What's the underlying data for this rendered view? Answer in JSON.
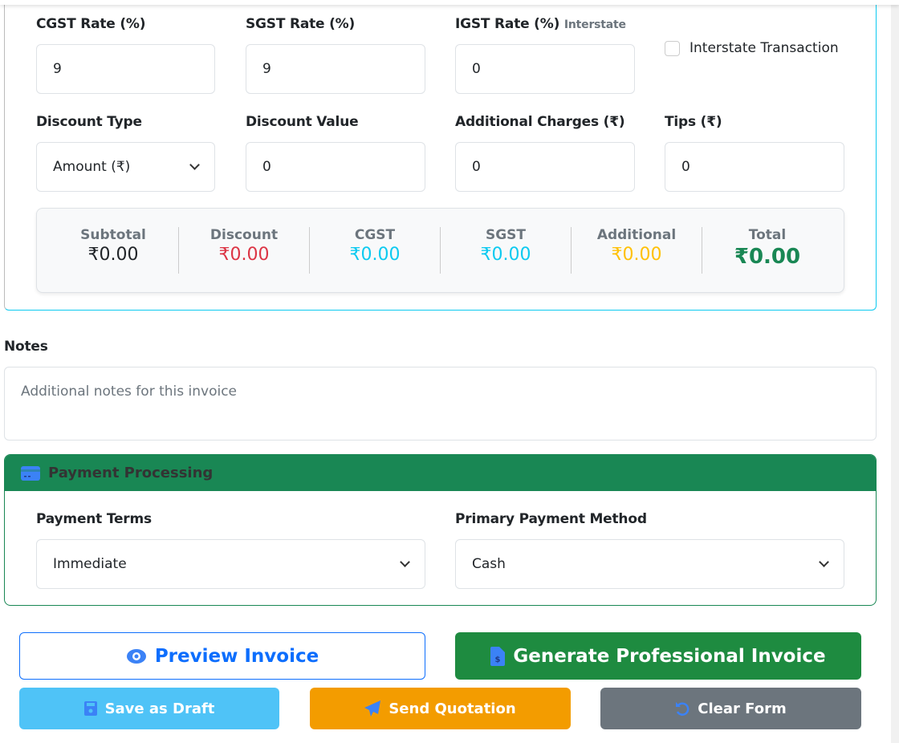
{
  "tax": {
    "cgst": {
      "label": "CGST Rate (%)",
      "value": "9"
    },
    "sgst": {
      "label": "SGST Rate (%)",
      "value": "9"
    },
    "igst": {
      "label": "IGST Rate (%)",
      "hint": "Interstate",
      "value": "0"
    },
    "interstate_label": "Interstate Transaction",
    "discount_type": {
      "label": "Discount Type",
      "value": "Amount (₹)"
    },
    "discount_value": {
      "label": "Discount Value",
      "value": "0"
    },
    "additional": {
      "label": "Additional Charges (₹)",
      "value": "0"
    },
    "tips": {
      "label": "Tips (₹)",
      "value": "0"
    }
  },
  "summary": [
    {
      "label": "Subtotal",
      "value": "₹0.00",
      "color": "#212529"
    },
    {
      "label": "Discount",
      "value": "₹0.00",
      "color": "#dc3545"
    },
    {
      "label": "CGST",
      "value": "₹0.00",
      "color": "#0dcaf0"
    },
    {
      "label": "SGST",
      "value": "₹0.00",
      "color": "#0dcaf0"
    },
    {
      "label": "Additional",
      "value": "₹0.00",
      "color": "#ffc107"
    },
    {
      "label": "Total",
      "value": "₹0.00",
      "color": "#198754"
    }
  ],
  "notes": {
    "label": "Notes",
    "placeholder": "Additional notes for this invoice"
  },
  "payment": {
    "title": "Payment Processing",
    "terms": {
      "label": "Payment Terms",
      "value": "Immediate"
    },
    "method": {
      "label": "Primary Payment Method",
      "value": "Cash"
    }
  },
  "actions": {
    "preview": "Preview Invoice",
    "generate": "Generate Professional Invoice",
    "draft": "Save as Draft",
    "quotation": "Send Quotation",
    "clear": "Clear Form"
  }
}
